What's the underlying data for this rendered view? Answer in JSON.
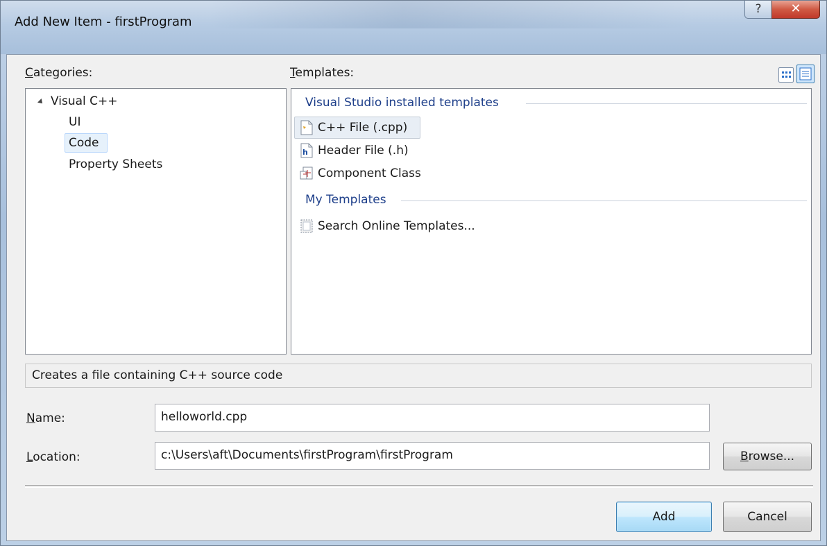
{
  "window": {
    "title": "Add New Item - firstProgram",
    "help_glyph": "?",
    "close_glyph": "✕"
  },
  "categories": {
    "label_accel": "C",
    "label_rest": "ategories:",
    "root": "Visual C++",
    "children": [
      "UI",
      "Code",
      "Property Sheets"
    ],
    "selected": "Code"
  },
  "templates": {
    "label_accel": "T",
    "label_rest": "emplates:",
    "groups": [
      {
        "header": "Visual Studio installed templates",
        "items": [
          {
            "label": "C++ File (.cpp)",
            "icon": "cpp-file-icon",
            "selected": true
          },
          {
            "label": "Header File (.h)",
            "icon": "header-file-icon",
            "selected": false
          },
          {
            "label": "Component Class",
            "icon": "component-class-icon",
            "selected": false
          }
        ]
      },
      {
        "header": "My Templates",
        "items": [
          {
            "label": "Search Online Templates...",
            "icon": "search-online-icon",
            "selected": false
          }
        ]
      }
    ]
  },
  "description": "Creates a file containing C++ source code",
  "name_field": {
    "label_accel": "N",
    "label_rest": "ame:",
    "value": "helloworld.cpp"
  },
  "location_field": {
    "label_accel": "L",
    "label_rest": "ocation:",
    "value": "c:\\Users\\aft\\Documents\\firstProgram\\firstProgram"
  },
  "buttons": {
    "browse_accel": "B",
    "browse_rest": "rowse...",
    "add": "Add",
    "cancel": "Cancel"
  },
  "colors": {
    "accent_header": "#1e3f8a",
    "close_button": "#c0392b"
  }
}
